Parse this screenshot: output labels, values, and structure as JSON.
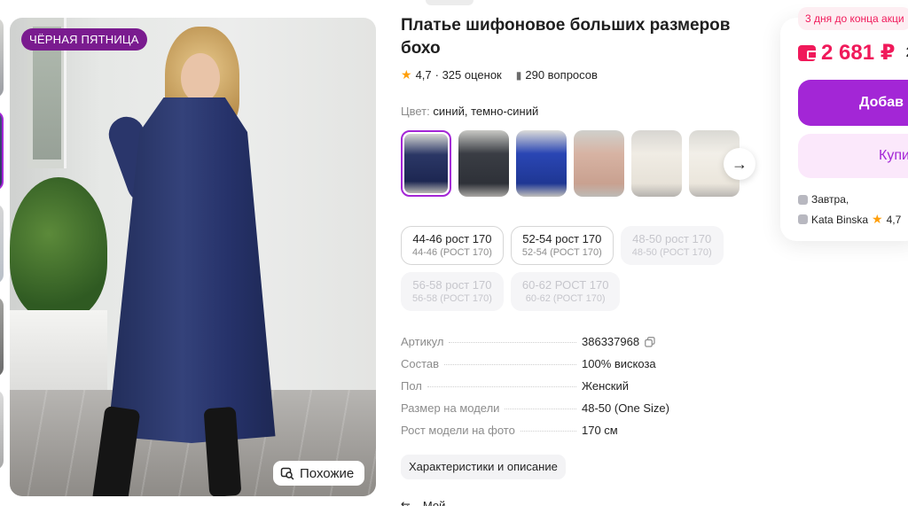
{
  "gallery": {
    "promo_badge": "ЧЁРНАЯ ПЯТНИЦА",
    "similar_label": "Похожие"
  },
  "product": {
    "title": "Платье шифоновое больших размеров бохо",
    "rating": "4,7",
    "reviews": "· 325 оценок",
    "questions": "290 вопросов",
    "color_label": "Цвет:",
    "color_value": "синий, темно-синий"
  },
  "sizes": [
    {
      "primary": "44-46 рост 170",
      "secondary": "44-46 (РОСТ 170)",
      "available": true
    },
    {
      "primary": "52-54 рост 170",
      "secondary": "52-54 (РОСТ 170)",
      "available": true
    },
    {
      "primary": "48-50 рост 170",
      "secondary": "48-50 (РОСТ 170)",
      "available": false
    },
    {
      "primary": "56-58 рост 170",
      "secondary": "56-58 (РОСТ 170)",
      "available": false
    },
    {
      "primary": "60-62 РОСТ 170",
      "secondary": "60-62 (РОСТ 170)",
      "available": false
    }
  ],
  "specs": [
    {
      "key": "Артикул",
      "value": "386337968"
    },
    {
      "key": "Состав",
      "value": "100% вискоза"
    },
    {
      "key": "Пол",
      "value": "Женский"
    },
    {
      "key": "Размер на модели",
      "value": "48-50 (One Size)"
    },
    {
      "key": "Рост модели на фото",
      "value": "170 см"
    }
  ],
  "description_button": "Характеристики и описание",
  "bottom_partial": "Мой",
  "card": {
    "deal": "3 дня до конца акци",
    "price": "2 681 ₽",
    "old_price": "2",
    "add_label": "Добав",
    "buy_label": "Купи",
    "delivery": "Завтра,",
    "seller": "Kata Binska",
    "seller_rating": "4,7"
  },
  "colors": {
    "accent": "#a326d6",
    "price": "#f0195a",
    "promo": "#7a1b8f",
    "star": "#ff9f0a"
  }
}
